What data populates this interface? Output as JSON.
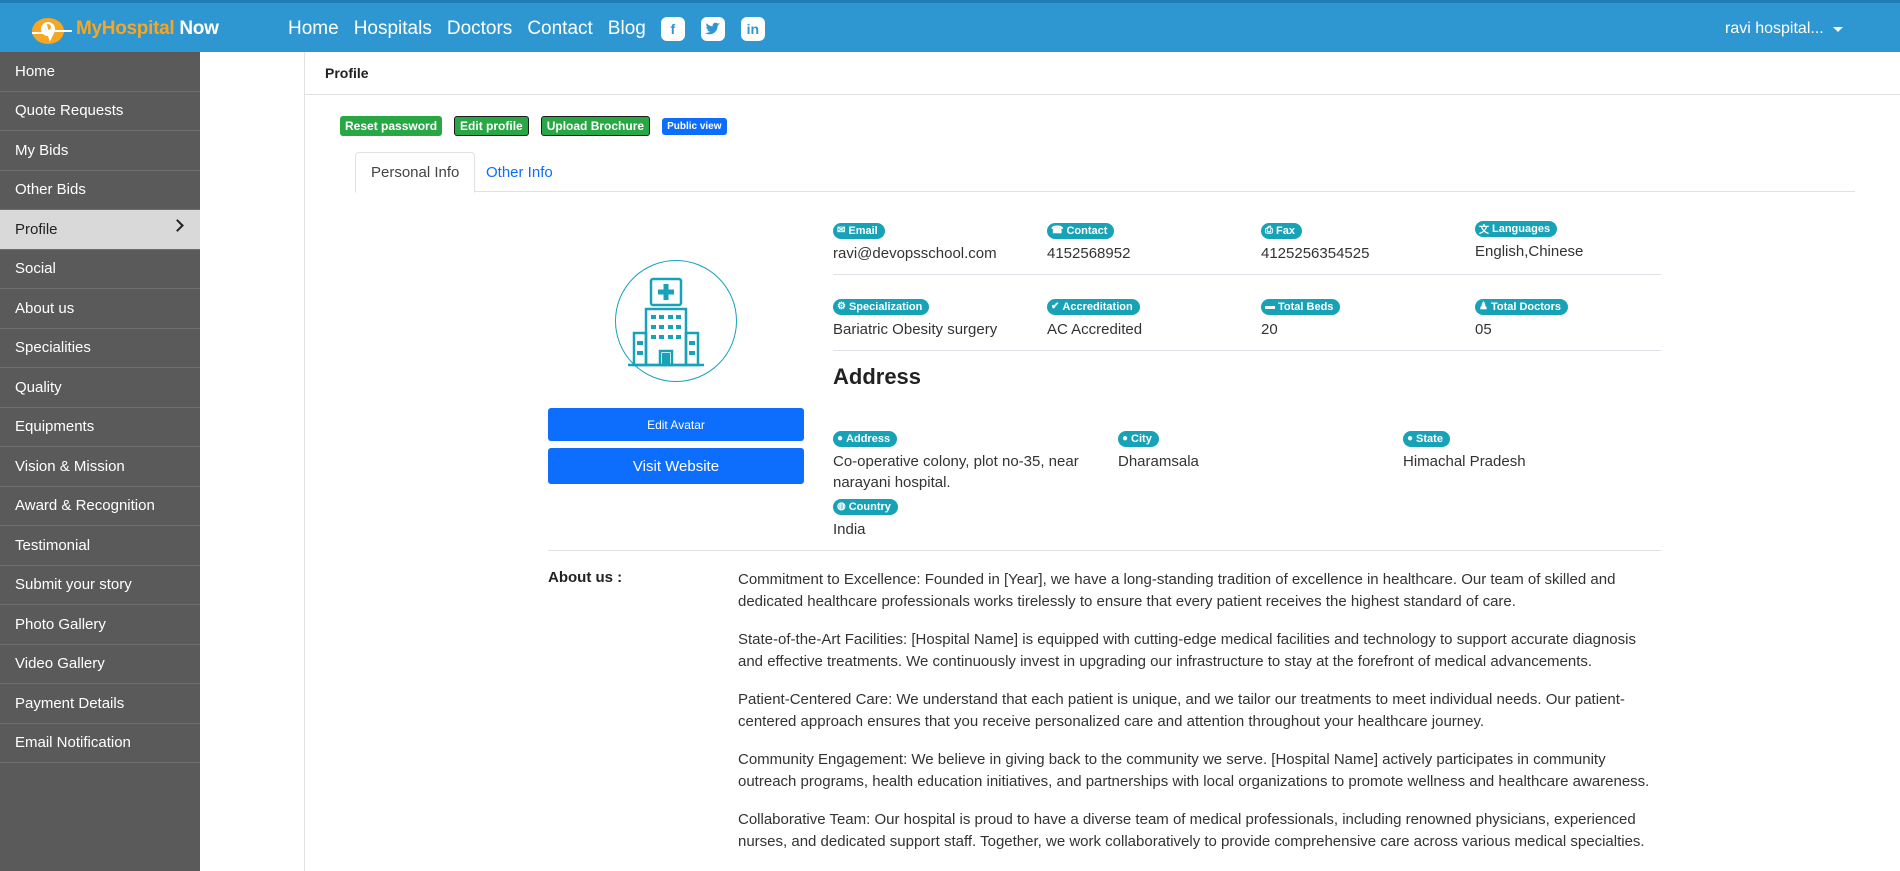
{
  "brand": {
    "part1": "MyHospital",
    "part2": "Now"
  },
  "nav": {
    "links": [
      "Home",
      "Hospitals",
      "Doctors",
      "Contact",
      "Blog"
    ],
    "social": [
      "f",
      "t",
      "in"
    ],
    "user": "ravi hospital..."
  },
  "sidebar": {
    "items": [
      "Home",
      "Quote Requests",
      "My Bids",
      "Other Bids",
      "Profile",
      "Social",
      "About us",
      "Specialities",
      "Quality",
      "Equipments",
      "Vision & Mission",
      "Award & Recognition",
      "Testimonial",
      "Submit your story",
      "Photo Gallery",
      "Video Gallery",
      "Payment Details",
      "Email Notification"
    ],
    "active": "Profile"
  },
  "page": {
    "title": "Profile"
  },
  "actions": {
    "reset": "Reset password",
    "edit": "Edit profile",
    "upload": "Upload Brochure",
    "public": "Public view"
  },
  "tabs": {
    "personal": "Personal Info",
    "other": "Other Info"
  },
  "avatar": {
    "edit": "Edit Avatar",
    "visit": "Visit Website"
  },
  "info": {
    "email": {
      "label": "Email",
      "value": "ravi@devopsschool.com"
    },
    "contact": {
      "label": "Contact",
      "value": "4152568952"
    },
    "fax": {
      "label": "Fax",
      "value": "4125256354525"
    },
    "languages": {
      "label": "Languages",
      "value": "English,Chinese"
    },
    "specialization": {
      "label": "Specialization",
      "value": "Bariatric Obesity surgery"
    },
    "accreditation": {
      "label": "Accreditation",
      "value": "AC Accredited"
    },
    "beds": {
      "label": "Total Beds",
      "value": "20"
    },
    "doctors": {
      "label": "Total Doctors",
      "value": "05"
    }
  },
  "address": {
    "title": "Address",
    "address": {
      "label": "Address",
      "value": "Co-operative colony, plot no-35, near narayani hospital."
    },
    "city": {
      "label": "City",
      "value": "Dharamsala"
    },
    "state": {
      "label": "State",
      "value": "Himachal Pradesh"
    },
    "country": {
      "label": "Country",
      "value": "India"
    }
  },
  "about": {
    "label": "About us :",
    "paragraphs": [
      "Commitment to Excellence: Founded in [Year], we have a long-standing tradition of excellence in healthcare. Our team of skilled and dedicated healthcare professionals works tirelessly to ensure that every patient receives the highest standard of care.",
      "State-of-the-Art Facilities: [Hospital Name] is equipped with cutting-edge medical facilities and technology to support accurate diagnosis and effective treatments. We continuously invest in upgrading our infrastructure to stay at the forefront of medical advancements.",
      "Patient-Centered Care: We understand that each patient is unique, and we tailor our treatments to meet individual needs. Our patient-centered approach ensures that you receive personalized care and attention throughout your healthcare journey.",
      "Community Engagement: We believe in giving back to the community we serve. [Hospital Name] actively participates in community outreach programs, health education initiatives, and partnerships with local organizations to promote wellness and healthcare awareness.",
      "Collaborative Team: Our hospital is proud to have a diverse team of medical professionals, including renowned physicians, experienced nurses, and dedicated support staff. Together, we work collaboratively to provide comprehensive care across various medical specialties."
    ]
  },
  "colors": {
    "navbar": "#2e96d0",
    "sidebar": "#5a5a5a",
    "badge": "#17a2b8",
    "primary": "#0d6efd",
    "success": "#28a745"
  }
}
